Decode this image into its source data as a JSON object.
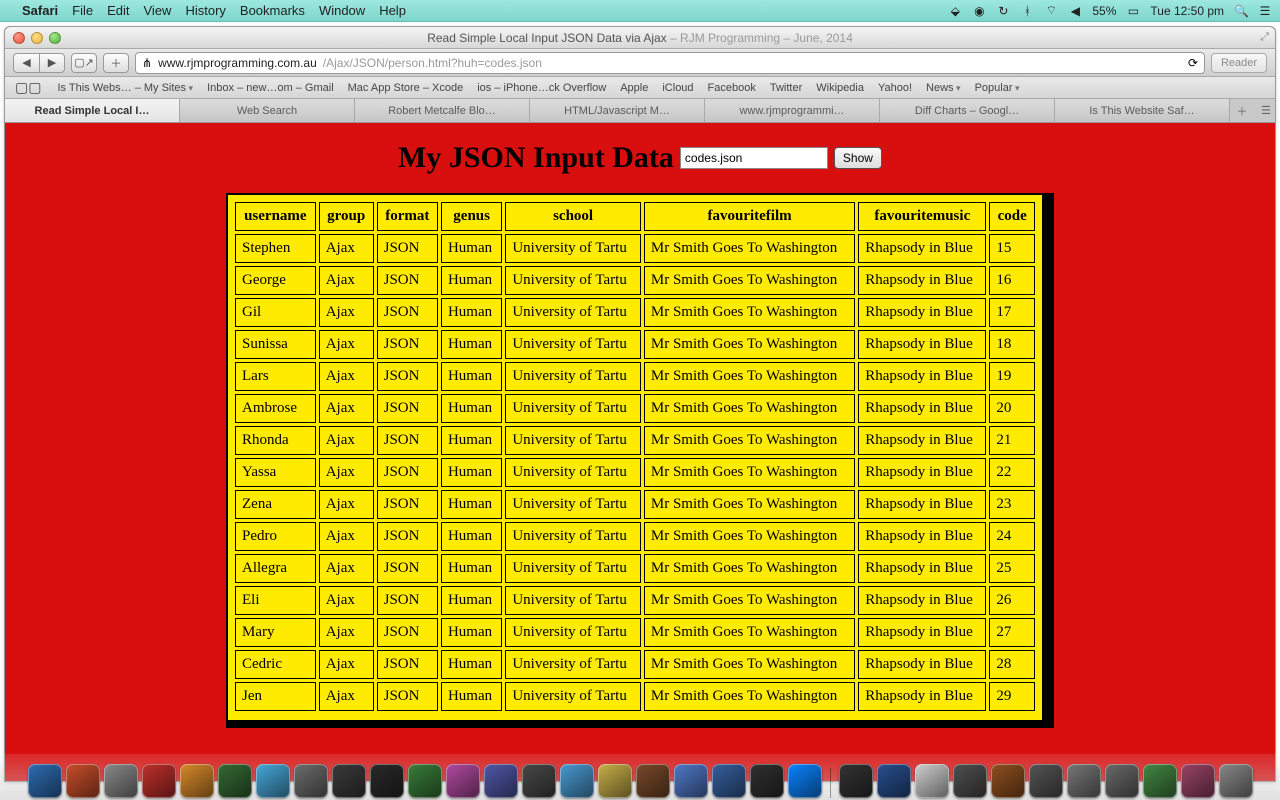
{
  "menubar": {
    "app": "Safari",
    "items": [
      "File",
      "Edit",
      "View",
      "History",
      "Bookmarks",
      "Window",
      "Help"
    ],
    "battery": "55%",
    "clock": "Tue 12:50 pm"
  },
  "window": {
    "title_main": "Read Simple Local Input JSON Data via Ajax",
    "title_suffix": " – RJM Programming – June, 2014",
    "url_host": "www.rjmprogramming.com.au",
    "url_path": "/Ajax/JSON/person.html?huh=codes.json",
    "reader": "Reader"
  },
  "bookmarks": [
    "Is This Webs… – My Sites",
    "Inbox – new…om – Gmail",
    "Mac App Store – Xcode",
    "ios – iPhone…ck Overflow",
    "Apple",
    "iCloud",
    "Facebook",
    "Twitter",
    "Wikipedia",
    "Yahoo!",
    "News",
    "Popular"
  ],
  "tabs": [
    {
      "label": "Read Simple Local I…",
      "active": true
    },
    {
      "label": "Web Search",
      "active": false
    },
    {
      "label": "Robert Metcalfe Blo…",
      "active": false
    },
    {
      "label": "HTML/Javascript M…",
      "active": false
    },
    {
      "label": "www.rjmprogrammi…",
      "active": false
    },
    {
      "label": "Diff Charts – Googl…",
      "active": false
    },
    {
      "label": "Is This Website Saf…",
      "active": false
    }
  ],
  "page": {
    "heading": "My JSON Input Data",
    "input_value": "codes.json",
    "button": "Show"
  },
  "table": {
    "headers": [
      "username",
      "group",
      "format",
      "genus",
      "school",
      "favouritefilm",
      "favouritemusic",
      "code"
    ],
    "rows": [
      [
        "Stephen",
        "Ajax",
        "JSON",
        "Human",
        "University of Tartu",
        "Mr Smith Goes To Washington",
        "Rhapsody in Blue",
        "15"
      ],
      [
        "George",
        "Ajax",
        "JSON",
        "Human",
        "University of Tartu",
        "Mr Smith Goes To Washington",
        "Rhapsody in Blue",
        "16"
      ],
      [
        "Gil",
        "Ajax",
        "JSON",
        "Human",
        "University of Tartu",
        "Mr Smith Goes To Washington",
        "Rhapsody in Blue",
        "17"
      ],
      [
        "Sunissa",
        "Ajax",
        "JSON",
        "Human",
        "University of Tartu",
        "Mr Smith Goes To Washington",
        "Rhapsody in Blue",
        "18"
      ],
      [
        "Lars",
        "Ajax",
        "JSON",
        "Human",
        "University of Tartu",
        "Mr Smith Goes To Washington",
        "Rhapsody in Blue",
        "19"
      ],
      [
        "Ambrose",
        "Ajax",
        "JSON",
        "Human",
        "University of Tartu",
        "Mr Smith Goes To Washington",
        "Rhapsody in Blue",
        "20"
      ],
      [
        "Rhonda",
        "Ajax",
        "JSON",
        "Human",
        "University of Tartu",
        "Mr Smith Goes To Washington",
        "Rhapsody in Blue",
        "21"
      ],
      [
        "Yassa",
        "Ajax",
        "JSON",
        "Human",
        "University of Tartu",
        "Mr Smith Goes To Washington",
        "Rhapsody in Blue",
        "22"
      ],
      [
        "Zena",
        "Ajax",
        "JSON",
        "Human",
        "University of Tartu",
        "Mr Smith Goes To Washington",
        "Rhapsody in Blue",
        "23"
      ],
      [
        "Pedro",
        "Ajax",
        "JSON",
        "Human",
        "University of Tartu",
        "Mr Smith Goes To Washington",
        "Rhapsody in Blue",
        "24"
      ],
      [
        "Allegra",
        "Ajax",
        "JSON",
        "Human",
        "University of Tartu",
        "Mr Smith Goes To Washington",
        "Rhapsody in Blue",
        "25"
      ],
      [
        "Eli",
        "Ajax",
        "JSON",
        "Human",
        "University of Tartu",
        "Mr Smith Goes To Washington",
        "Rhapsody in Blue",
        "26"
      ],
      [
        "Mary",
        "Ajax",
        "JSON",
        "Human",
        "University of Tartu",
        "Mr Smith Goes To Washington",
        "Rhapsody in Blue",
        "27"
      ],
      [
        "Cedric",
        "Ajax",
        "JSON",
        "Human",
        "University of Tartu",
        "Mr Smith Goes To Washington",
        "Rhapsody in Blue",
        "28"
      ],
      [
        "Jen",
        "Ajax",
        "JSON",
        "Human",
        "University of Tartu",
        "Mr Smith Goes To Washington",
        "Rhapsody in Blue",
        "29"
      ]
    ]
  },
  "dock_colors": [
    "#2d6db3",
    "#c94f2b",
    "#8a8a8a",
    "#c0302b",
    "#d88a2a",
    "#356a33",
    "#47a7d8",
    "#6d6d6d",
    "#3b3b3b",
    "#2a2a2a",
    "#3a7d3a",
    "#b24aa0",
    "#5058a8",
    "#494949",
    "#4a9ad1",
    "#c8b04a",
    "#7a4a2a",
    "#5078c8",
    "#365f9e",
    "#303030",
    "#0a84ff",
    "#333333",
    "#274f8f",
    "#d0d0d0",
    "#505050",
    "#905020",
    "#555555",
    "#777777",
    "#6a6a6a",
    "#448844",
    "#994466",
    "#888888"
  ]
}
